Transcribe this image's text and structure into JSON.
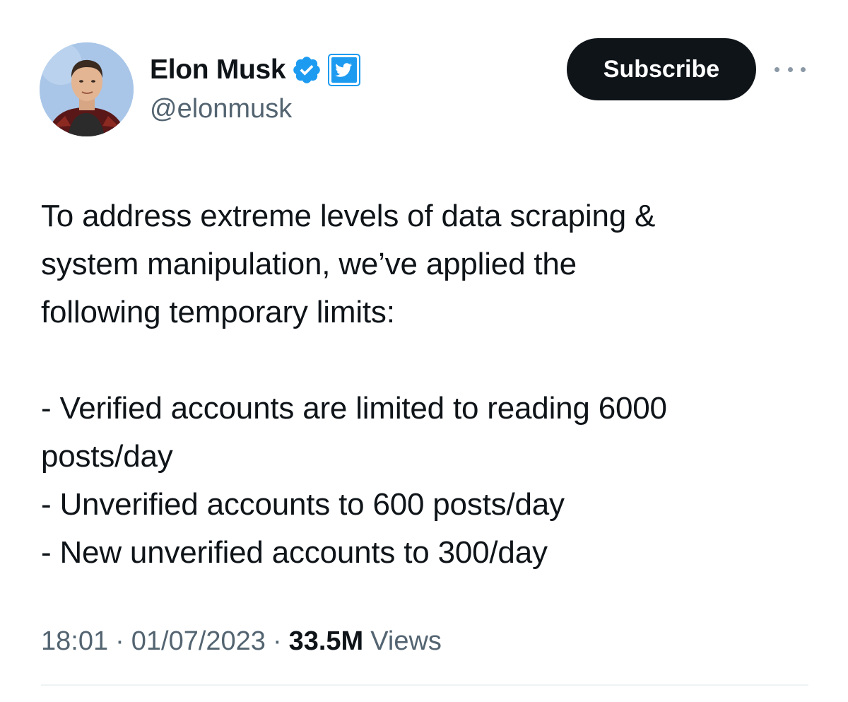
{
  "author": {
    "display_name": "Elon Musk",
    "handle": "@elonmusk",
    "badges": [
      "verified-checkmark-icon",
      "twitter-bird-affiliate-icon"
    ]
  },
  "actions": {
    "subscribe_label": "Subscribe",
    "more_icon": "more-horizontal-icon"
  },
  "tweet": {
    "lines": [
      "To address extreme levels of data scraping &",
      "system manipulation, we’ve applied the",
      "following temporary limits:",
      "",
      "- Verified accounts are limited to reading 6000",
      "posts/day",
      "- Unverified accounts to 600 posts/day",
      "- New unverified accounts to 300/day"
    ]
  },
  "meta": {
    "time": "18:01",
    "date": "01/07/2023",
    "views_count": "33.5M",
    "views_label": "Views",
    "separator": "·"
  },
  "colors": {
    "text": "#0f1419",
    "secondary": "#536471",
    "button_bg": "#0f1419",
    "verified_blue": "#1d9bf0"
  }
}
